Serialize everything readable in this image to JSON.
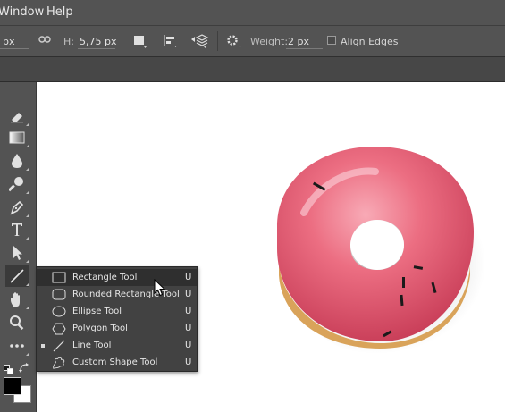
{
  "menubar": {
    "window_label": "Window",
    "help_label": "Help"
  },
  "options": {
    "w_unit": "px",
    "link_icon": "link-icon",
    "h_label": "H:",
    "h_value": "5,75 px",
    "weight_label": "Weight:",
    "weight_value": "2 px",
    "align_edges_label": "Align Edges",
    "align_edges_checked": false
  },
  "flyout": {
    "items": [
      {
        "label": "Rectangle Tool",
        "key": "U",
        "icon": "rectangle-icon",
        "hover": true,
        "active": false
      },
      {
        "label": "Rounded Rectangle Tool",
        "key": "U",
        "icon": "rounded-rectangle-icon",
        "hover": false,
        "active": false
      },
      {
        "label": "Ellipse Tool",
        "key": "U",
        "icon": "ellipse-icon",
        "hover": false,
        "active": false
      },
      {
        "label": "Polygon Tool",
        "key": "U",
        "icon": "polygon-icon",
        "hover": false,
        "active": false
      },
      {
        "label": "Line Tool",
        "key": "U",
        "icon": "line-icon",
        "hover": false,
        "active": true
      },
      {
        "label": "Custom Shape Tool",
        "key": "U",
        "icon": "custom-shape-icon",
        "hover": false,
        "active": false
      }
    ]
  },
  "colors": {
    "foreground": "#000000",
    "background": "#ffffff",
    "donut_glaze": "#e8556c",
    "donut_dough": "#d9a35a"
  }
}
